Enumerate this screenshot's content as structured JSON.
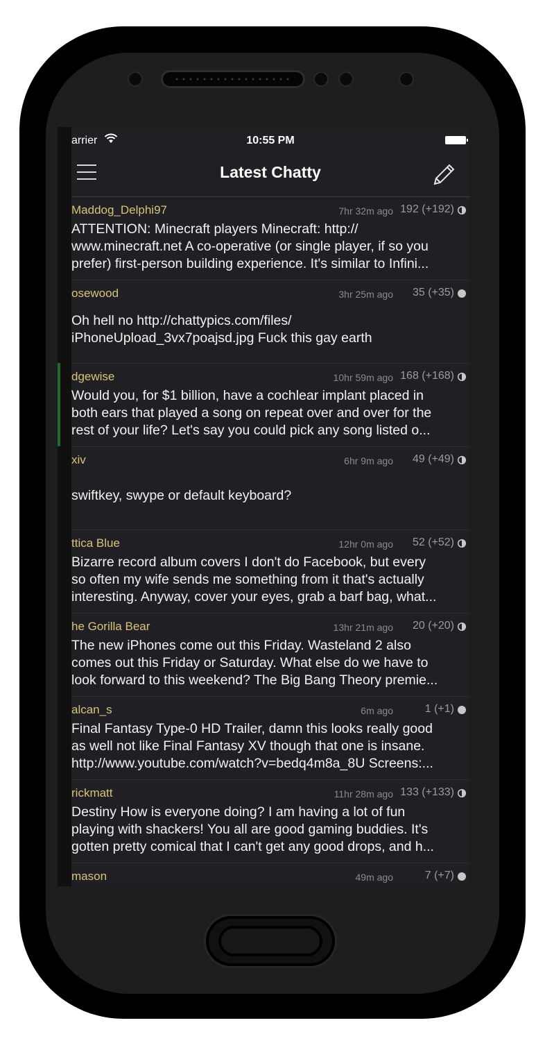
{
  "status": {
    "carrier": "arrier",
    "time": "10:55 PM"
  },
  "navbar": {
    "title": "Latest Chatty",
    "menu_icon": "hamburger-menu-icon",
    "compose_icon": "pencil-compose-icon"
  },
  "posts": [
    {
      "author": "Maddog_Delphi97",
      "time": "7hr 32m ago",
      "count": "192 (+192)",
      "indicator": "half",
      "body": "ATTENTION: Minecraft players Minecraft: http://\nwww.minecraft.net A co-operative (or single player, if so you\nprefer) first-person building experience. It's similar to Infini..."
    },
    {
      "author": "osewood",
      "time": "3hr 25m ago",
      "count": "35 (+35)",
      "indicator": "full",
      "body": "Oh hell no http://chattypics.com/files/\niPhoneUpload_3vx7poajsd.jpg Fuck this gay earth"
    },
    {
      "author": "dgewise",
      "time": "10hr 59m ago",
      "count": "168 (+168)",
      "indicator": "half",
      "body": "Would you, for $1 billion, have a cochlear implant placed in\nboth ears that played a song on repeat over and over for the\nrest of your life? Let's say you could pick any song listed o..."
    },
    {
      "author": "xiv",
      "time": "6hr 9m ago",
      "count": "49 (+49)",
      "indicator": "half",
      "body": "swiftkey, swype or default keyboard?"
    },
    {
      "author": "ttica Blue",
      "time": "12hr 0m ago",
      "count": "52 (+52)",
      "indicator": "half",
      "body": "Bizarre record album covers I don't do Facebook, but every\nso often my wife sends me something from it that's actually\ninteresting. Anyway, cover your eyes, grab a barf bag, what..."
    },
    {
      "author": "he Gorilla Bear",
      "time": "13hr 21m ago",
      "count": "20 (+20)",
      "indicator": "half",
      "body": "The new iPhones come out this Friday. Wasteland 2 also\ncomes out this Friday or Saturday. What else do we have to\nlook forward to this weekend? The Big Bang Theory premie..."
    },
    {
      "author": "alcan_s",
      "time": "6m ago",
      "count": "1 (+1)",
      "indicator": "full",
      "body": "Final Fantasy Type-0 HD Trailer, damn this looks really good\nas well not like Final Fantasy XV though that one is insane.\nhttp://www.youtube.com/watch?v=bedq4m8a_8U Screens:..."
    },
    {
      "author": "rickmatt",
      "time": "11hr 28m ago",
      "count": "133 (+133)",
      "indicator": "half",
      "body": "Destiny How is everyone doing? I am having a lot of fun\nplaying with shackers! You all are good gaming buddies. It's\ngotten pretty comical that I can't get any good drops, and h..."
    },
    {
      "author": "mason",
      "time": "49m ago",
      "count": "7 (+7)",
      "indicator": "full",
      "body": ""
    }
  ]
}
